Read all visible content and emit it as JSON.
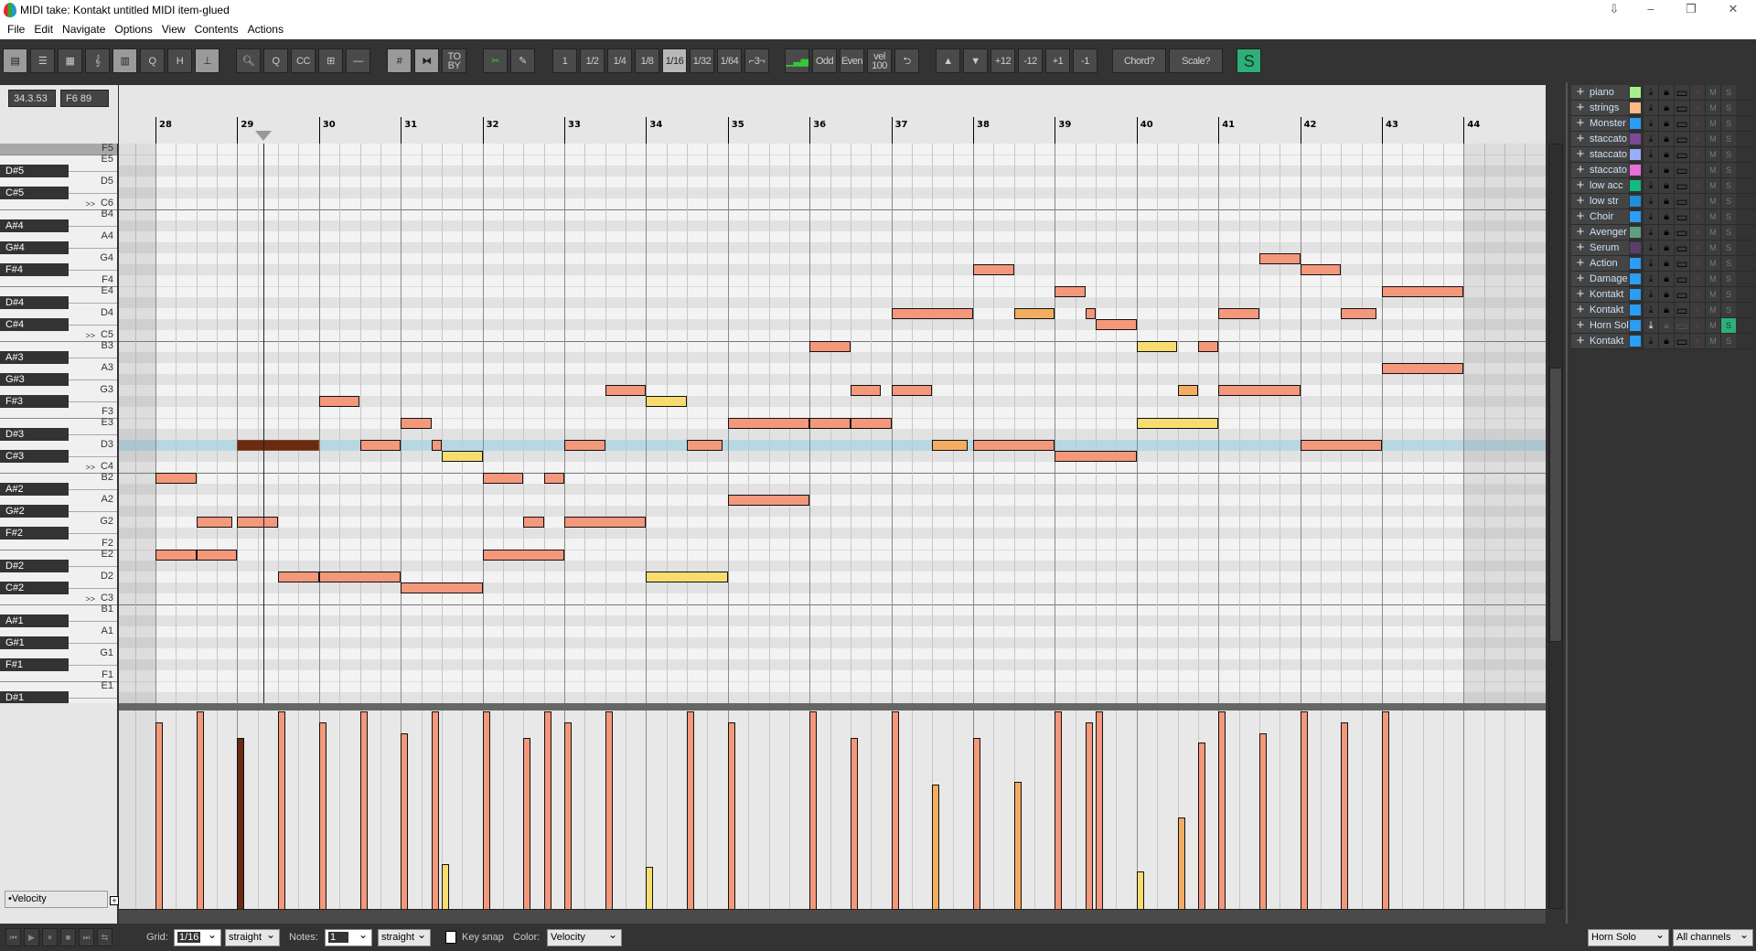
{
  "window": {
    "title": "MIDI take: Kontakt untitled MIDI item-glued",
    "controls": [
      "⇩",
      "–",
      "❐",
      "✕"
    ]
  },
  "menu": [
    "File",
    "Edit",
    "Navigate",
    "Options",
    "View",
    "Contents",
    "Actions"
  ],
  "toolbar": {
    "groups": [
      [
        {
          "icon": "piano-roll-view-icon",
          "label": "▤",
          "style": "light"
        },
        {
          "icon": "named-notes-view-icon",
          "label": "☰"
        },
        {
          "icon": "drum-view-icon",
          "label": "▦"
        },
        {
          "icon": "notation-view-icon",
          "label": "𝄞"
        },
        {
          "icon": "event-list-icon",
          "label": "▥",
          "style": "light"
        },
        {
          "icon": "quantize-icon",
          "label": "Q"
        },
        {
          "icon": "humanize-icon",
          "label": "H"
        },
        {
          "icon": "legato-icon",
          "label": "⊥",
          "style": "light"
        }
      ],
      [
        {
          "icon": "zoom-icon",
          "label": "🔍︎"
        },
        {
          "icon": "zoom-content-icon",
          "label": "Q"
        },
        {
          "icon": "cc-icon",
          "label": "CC"
        },
        {
          "icon": "cc-lanes-icon",
          "label": "⊞"
        },
        {
          "icon": "minus-icon",
          "label": "—"
        }
      ],
      [
        {
          "icon": "grid-icon",
          "label": "#",
          "style": "light"
        },
        {
          "icon": "snap-icon",
          "label": "⧓",
          "style": "light"
        },
        {
          "icon": "to-by-icon",
          "label": "TO BY"
        }
      ],
      [
        {
          "icon": "split-icon",
          "label": "✂"
        },
        {
          "icon": "pencil-icon",
          "label": "✎"
        }
      ],
      [
        {
          "label": "1"
        },
        {
          "label": "1/2"
        },
        {
          "label": "1/4"
        },
        {
          "label": "1/8"
        },
        {
          "label": "1/16",
          "style": "active"
        },
        {
          "label": "1/32"
        },
        {
          "label": "1/64"
        },
        {
          "label": "⌐3¬"
        }
      ],
      [
        {
          "icon": "velocity-ramp-icon",
          "label": "▁▃▅"
        },
        {
          "label": "Odd"
        },
        {
          "label": "Even"
        },
        {
          "label": "vel 100"
        },
        {
          "icon": "undo-icon",
          "label": "⮌"
        }
      ],
      [
        {
          "icon": "transpose-up-icon",
          "label": "▲"
        },
        {
          "icon": "transpose-down-icon",
          "label": "▼"
        },
        {
          "label": "+12"
        },
        {
          "label": "-12"
        },
        {
          "label": "+1"
        },
        {
          "label": "-1"
        }
      ],
      [
        {
          "label": "Chord?",
          "style": "wide"
        },
        {
          "label": "Scale?",
          "style": "wide"
        }
      ],
      [
        {
          "label": "S",
          "style": "green"
        }
      ]
    ]
  },
  "position_display": {
    "time": "34.3.53",
    "note": "F6 89"
  },
  "ruler": {
    "measures": [
      28,
      29,
      30,
      31,
      32,
      33,
      34,
      35,
      36,
      37,
      38,
      39,
      40,
      41,
      42,
      43,
      44
    ]
  },
  "playhead": {
    "bar": 29,
    "beat": 2.3
  },
  "keyboard": {
    "rows": [
      {
        "n": "F5",
        "t": "w"
      },
      {
        "n": "E5",
        "t": "w"
      },
      {
        "n": "D#5",
        "t": "b"
      },
      {
        "n": "D5",
        "t": "w"
      },
      {
        "n": "C#5",
        "t": "b"
      },
      {
        "n": "C6",
        "t": "w",
        "c": ">>"
      },
      {
        "n": "B4",
        "t": "w"
      },
      {
        "n": "A#4",
        "t": "b"
      },
      {
        "n": "A4",
        "t": "w"
      },
      {
        "n": "G#4",
        "t": "b"
      },
      {
        "n": "G4",
        "t": "w"
      },
      {
        "n": "F#4",
        "t": "b"
      },
      {
        "n": "F4",
        "t": "w"
      },
      {
        "n": "E4",
        "t": "w"
      },
      {
        "n": "D#4",
        "t": "b"
      },
      {
        "n": "D4",
        "t": "w"
      },
      {
        "n": "C#4",
        "t": "b"
      },
      {
        "n": "C5",
        "t": "w",
        "c": ">>"
      },
      {
        "n": "B3",
        "t": "w"
      },
      {
        "n": "A#3",
        "t": "b"
      },
      {
        "n": "A3",
        "t": "w"
      },
      {
        "n": "G#3",
        "t": "b"
      },
      {
        "n": "G3",
        "t": "w"
      },
      {
        "n": "F#3",
        "t": "b"
      },
      {
        "n": "F3",
        "t": "w"
      },
      {
        "n": "E3",
        "t": "w"
      },
      {
        "n": "D#3",
        "t": "b"
      },
      {
        "n": "D3",
        "t": "w"
      },
      {
        "n": "C#3",
        "t": "b"
      },
      {
        "n": "C4",
        "t": "w",
        "c": ">>"
      },
      {
        "n": "B2",
        "t": "w"
      },
      {
        "n": "A#2",
        "t": "b"
      },
      {
        "n": "A2",
        "t": "w"
      },
      {
        "n": "G#2",
        "t": "b"
      },
      {
        "n": "G2",
        "t": "w"
      },
      {
        "n": "F#2",
        "t": "b"
      },
      {
        "n": "F2",
        "t": "w"
      },
      {
        "n": "E2",
        "t": "w"
      },
      {
        "n": "D#2",
        "t": "b"
      },
      {
        "n": "D2",
        "t": "w"
      },
      {
        "n": "C#2",
        "t": "b"
      },
      {
        "n": "C3",
        "t": "w",
        "c": ">>"
      },
      {
        "n": "B1",
        "t": "w"
      },
      {
        "n": "A#1",
        "t": "b"
      },
      {
        "n": "A1",
        "t": "w"
      },
      {
        "n": "G#1",
        "t": "b"
      },
      {
        "n": "G1",
        "t": "w"
      },
      {
        "n": "F#1",
        "t": "b"
      },
      {
        "n": "F1",
        "t": "w"
      },
      {
        "n": "E1",
        "t": "w"
      },
      {
        "n": "D#1",
        "t": "b"
      }
    ],
    "highlighted": "D3"
  },
  "colors": {
    "high": "#f4987c",
    "mid": "#f3ad62",
    "low": "#f7dc6f",
    "selected": "#6b2a12"
  },
  "notes": [
    {
      "pitch": "B2",
      "bar": 28,
      "beat": 1,
      "len": 2,
      "vel": 120
    },
    {
      "pitch": "E2",
      "bar": 28,
      "beat": 1,
      "len": 2,
      "vel": 120
    },
    {
      "pitch": "E2",
      "bar": 28,
      "beat": 3,
      "len": 2,
      "vel": 127
    },
    {
      "pitch": "G2",
      "bar": 28,
      "beat": 3,
      "len": 1.75,
      "vel": 127
    },
    {
      "pitch": "G2",
      "bar": 29,
      "beat": 1,
      "len": 2,
      "vel": 110
    },
    {
      "pitch": "D3",
      "bar": 29,
      "beat": 1,
      "len": 4,
      "vel": 110,
      "selected": true
    },
    {
      "pitch": "D2",
      "bar": 29,
      "beat": 3,
      "len": 2,
      "vel": 127
    },
    {
      "pitch": "D2",
      "bar": 30,
      "beat": 1,
      "len": 4,
      "vel": 120
    },
    {
      "pitch": "F#3",
      "bar": 30,
      "beat": 1,
      "len": 2,
      "vel": 120
    },
    {
      "pitch": "D3",
      "bar": 30,
      "beat": 3,
      "len": 2,
      "vel": 127
    },
    {
      "pitch": "E3",
      "bar": 31,
      "beat": 1,
      "len": 1.5,
      "vel": 113
    },
    {
      "pitch": "C#2",
      "bar": 31,
      "beat": 1,
      "len": 4,
      "vel": 113
    },
    {
      "pitch": "D3",
      "bar": 31,
      "beat": 2.5,
      "len": 0.5,
      "vel": 127
    },
    {
      "pitch": "C#3",
      "bar": 31,
      "beat": 3,
      "len": 2,
      "vel": 29
    },
    {
      "pitch": "B2",
      "bar": 32,
      "beat": 1,
      "len": 2,
      "vel": 127
    },
    {
      "pitch": "E2",
      "bar": 32,
      "beat": 1,
      "len": 4,
      "vel": 127
    },
    {
      "pitch": "G2",
      "bar": 32,
      "beat": 3,
      "len": 1,
      "vel": 110
    },
    {
      "pitch": "B2",
      "bar": 32,
      "beat": 4,
      "len": 1,
      "vel": 127
    },
    {
      "pitch": "D3",
      "bar": 33,
      "beat": 1,
      "len": 2,
      "vel": 120
    },
    {
      "pitch": "G2",
      "bar": 33,
      "beat": 1,
      "len": 4,
      "vel": 120
    },
    {
      "pitch": "G3",
      "bar": 33,
      "beat": 3,
      "len": 2,
      "vel": 127
    },
    {
      "pitch": "F#3",
      "bar": 34,
      "beat": 1,
      "len": 2,
      "vel": 27
    },
    {
      "pitch": "D2",
      "bar": 34,
      "beat": 1,
      "len": 4,
      "vel": 27
    },
    {
      "pitch": "D3",
      "bar": 34,
      "beat": 3,
      "len": 1.75,
      "vel": 127
    },
    {
      "pitch": "E3",
      "bar": 35,
      "beat": 1,
      "len": 4,
      "vel": 120
    },
    {
      "pitch": "A2",
      "bar": 35,
      "beat": 1,
      "len": 4,
      "vel": 120
    },
    {
      "pitch": "B3",
      "bar": 36,
      "beat": 1,
      "len": 2,
      "vel": 127
    },
    {
      "pitch": "E3",
      "bar": 36,
      "beat": 1,
      "len": 2,
      "vel": 127
    },
    {
      "pitch": "G3",
      "bar": 36,
      "beat": 3,
      "len": 1.5,
      "vel": 110
    },
    {
      "pitch": "E3",
      "bar": 36,
      "beat": 3,
      "len": 2,
      "vel": 110
    },
    {
      "pitch": "G3",
      "bar": 37,
      "beat": 1,
      "len": 2,
      "vel": 127
    },
    {
      "pitch": "D4",
      "bar": 37,
      "beat": 1,
      "len": 4,
      "vel": 127
    },
    {
      "pitch": "D3",
      "bar": 37,
      "beat": 3,
      "len": 1.75,
      "vel": 80
    },
    {
      "pitch": "F#4",
      "bar": 38,
      "beat": 1,
      "len": 2,
      "vel": 110
    },
    {
      "pitch": "D3",
      "bar": 38,
      "beat": 1,
      "len": 4,
      "vel": 110
    },
    {
      "pitch": "D4",
      "bar": 38,
      "beat": 3,
      "len": 2,
      "vel": 82
    },
    {
      "pitch": "E4",
      "bar": 39,
      "beat": 1,
      "len": 1.5,
      "vel": 127
    },
    {
      "pitch": "D4",
      "bar": 39,
      "beat": 2.5,
      "len": 0.5,
      "vel": 120
    },
    {
      "pitch": "C#3",
      "bar": 39,
      "beat": 1,
      "len": 4,
      "vel": 127
    },
    {
      "pitch": "C#4",
      "bar": 39,
      "beat": 3,
      "len": 2,
      "vel": 127
    },
    {
      "pitch": "B3",
      "bar": 40,
      "beat": 1,
      "len": 2,
      "vel": 24
    },
    {
      "pitch": "E3",
      "bar": 40,
      "beat": 1,
      "len": 4,
      "vel": 24
    },
    {
      "pitch": "G3",
      "bar": 40,
      "beat": 3,
      "len": 1,
      "vel": 59
    },
    {
      "pitch": "B3",
      "bar": 40,
      "beat": 4,
      "len": 1,
      "vel": 107
    },
    {
      "pitch": "D4",
      "bar": 41,
      "beat": 1,
      "len": 2,
      "vel": 127
    },
    {
      "pitch": "G3",
      "bar": 41,
      "beat": 1,
      "len": 4,
      "vel": 127
    },
    {
      "pitch": "G4",
      "bar": 41,
      "beat": 3,
      "len": 2,
      "vel": 113
    },
    {
      "pitch": "F#4",
      "bar": 42,
      "beat": 1,
      "len": 2,
      "vel": 127
    },
    {
      "pitch": "D3",
      "bar": 42,
      "beat": 1,
      "len": 4,
      "vel": 127
    },
    {
      "pitch": "D4",
      "bar": 42,
      "beat": 3,
      "len": 1.75,
      "vel": 120
    },
    {
      "pitch": "E4",
      "bar": 43,
      "beat": 1,
      "len": 4,
      "vel": 127
    },
    {
      "pitch": "A3",
      "bar": 43,
      "beat": 1,
      "len": 4,
      "vel": 127
    }
  ],
  "cc_lane": {
    "selector": "•Velocity",
    "add": "+",
    "range": [
      0,
      127
    ]
  },
  "tracks": [
    {
      "name": "piano",
      "color": "#a6f08a"
    },
    {
      "name": "strings",
      "color": "#ffb987"
    },
    {
      "name": "Monster stac",
      "color": "#2a9df4"
    },
    {
      "name": "staccato",
      "color": "#7b4a96"
    },
    {
      "name": "staccato",
      "color": "#98aef8"
    },
    {
      "name": "staccato hi",
      "color": "#e86ed8"
    },
    {
      "name": "low acc",
      "color": "#11bb7f"
    },
    {
      "name": "low str",
      "color": "#1e8fd8"
    },
    {
      "name": "Choir",
      "color": "#2a9df4"
    },
    {
      "name": "Avenger",
      "color": "#5f9e80"
    },
    {
      "name": "Serum",
      "color": "#5a3d6a"
    },
    {
      "name": "Action",
      "color": "#2a9df4"
    },
    {
      "name": "Damage",
      "color": "#2a9df4"
    },
    {
      "name": "Kontakt",
      "color": "#2a9df4"
    },
    {
      "name": "Kontakt",
      "color": "#2a9df4"
    },
    {
      "name": "Horn Solo",
      "color": "#2a9df4",
      "active": true,
      "solo": true
    },
    {
      "name": "Kontakt",
      "color": "#2a9df4"
    }
  ],
  "track_buttons": {
    "mute": "M",
    "solo": "S",
    "add": "+"
  },
  "bottom": {
    "transport": [
      "⏮",
      "▶",
      "⏸",
      "■",
      "⏭",
      "⇆"
    ],
    "grid_label": "Grid:",
    "grid_value": "1/16",
    "grid_type": "straight",
    "notes_label": "Notes:",
    "notes_value": "1",
    "notes_type": "straight",
    "key_snap": "Key snap",
    "key_snap_checked": false,
    "color_label": "Color:",
    "color_value": "Velocity",
    "track": "Horn Solo",
    "channel": "All channels"
  }
}
